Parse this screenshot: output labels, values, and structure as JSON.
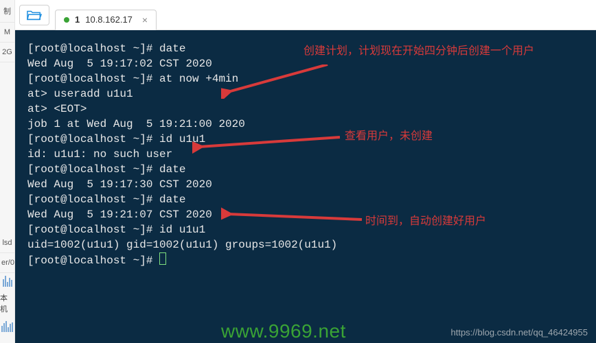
{
  "tab": {
    "index": "1",
    "title": "10.8.162.17",
    "dot_color": "#3aa335"
  },
  "sidebar": {
    "items": [
      "制",
      "M",
      "2G",
      "lsd",
      "er/0",
      "本机"
    ]
  },
  "terminal": {
    "lines": [
      "[root@localhost ~]# date",
      "Wed Aug  5 19:17:02 CST 2020",
      "[root@localhost ~]# at now +4min",
      "at> useradd u1u1",
      "at> <EOT>",
      "job 1 at Wed Aug  5 19:21:00 2020",
      "[root@localhost ~]# id u1u1",
      "id: u1u1: no such user",
      "[root@localhost ~]# date",
      "Wed Aug  5 19:17:30 CST 2020",
      "[root@localhost ~]# date",
      "Wed Aug  5 19:21:07 CST 2020",
      "[root@localhost ~]# id u1u1",
      "uid=1002(u1u1) gid=1002(u1u1) groups=1002(u1u1)",
      "[root@localhost ~]# "
    ]
  },
  "annotations": {
    "a1": "创建计划，计划现在开始四分钟后创建一个用户",
    "a2": "查看用户，未创建",
    "a3": "时间到，自动创建好用户"
  },
  "watermark": {
    "green": "www.9969.net",
    "url": "https://blog.csdn.net/qq_46424955"
  }
}
